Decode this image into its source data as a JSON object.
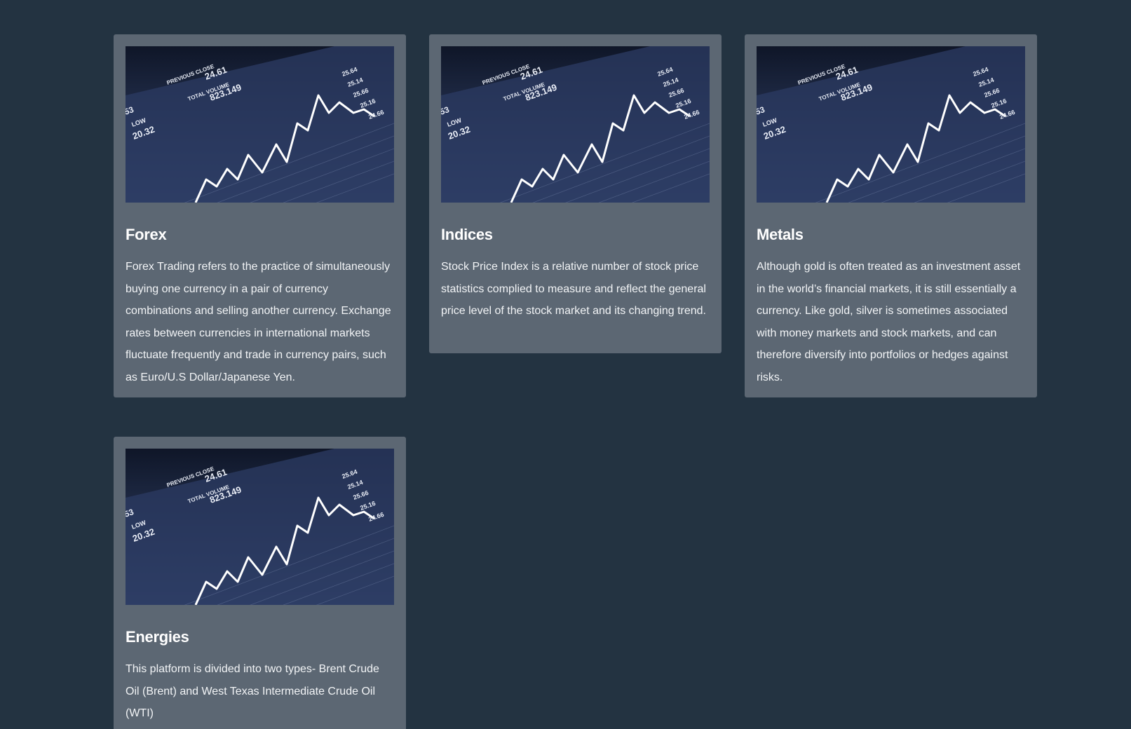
{
  "cards": [
    {
      "id": "forex",
      "image": {
        "icon": "stock-chart-image",
        "labels": {
          "previous_close_label": "PREVIOUS CLOSE",
          "previous_close_value": "24.61",
          "total_volume_label": "TOTAL VOLUME",
          "total_volume_value": "823.149",
          "low_label": "LOW",
          "low_value": "20.32",
          "left_value": "53",
          "right_values": [
            "25.64",
            "25.14",
            "25.66",
            "25.16",
            "24.66"
          ]
        }
      },
      "title": "Forex",
      "text": "Forex Trading refers to the practice of simultaneously buying one currency in a pair of currency combinations and selling another currency. Exchange rates between currencies in international markets fluctuate frequently and trade in currency pairs, such as Euro/U.S Dollar/Japanese Yen."
    },
    {
      "id": "indices",
      "image": {
        "icon": "stock-chart-image",
        "labels": {
          "previous_close_label": "PREVIOUS CLOSE",
          "previous_close_value": "24.61",
          "total_volume_label": "TOTAL VOLUME",
          "total_volume_value": "823.149",
          "low_label": "LOW",
          "low_value": "20.32",
          "left_value": "53",
          "right_values": [
            "25.64",
            "25.14",
            "25.66",
            "25.16",
            "24.66"
          ]
        }
      },
      "title": "Indices",
      "text": "Stock Price Index is a relative number of stock price statistics complied to measure and reflect the general price level of the stock market and its changing trend."
    },
    {
      "id": "metals",
      "image": {
        "icon": "stock-chart-image",
        "labels": {
          "previous_close_label": "PREVIOUS CLOSE",
          "previous_close_value": "24.61",
          "total_volume_label": "TOTAL VOLUME",
          "total_volume_value": "823.149",
          "low_label": "LOW",
          "low_value": "20.32",
          "left_value": "53",
          "right_values": [
            "25.64",
            "25.14",
            "25.66",
            "25.16",
            "24.66"
          ]
        }
      },
      "title": "Metals",
      "text": "Although gold is often treated as an investment asset in the world’s financial markets, it is still essentially a currency. Like gold, silver is sometimes associated with money markets and stock markets, and can therefore diversify into portfolios or hedges against risks."
    },
    {
      "id": "energies",
      "image": {
        "icon": "stock-chart-image",
        "labels": {
          "previous_close_label": "PREVIOUS CLOSE",
          "previous_close_value": "24.61",
          "total_volume_label": "TOTAL VOLUME",
          "total_volume_value": "823.149",
          "low_label": "LOW",
          "low_value": "20.32",
          "left_value": "53",
          "right_values": [
            "25.64",
            "25.14",
            "25.66",
            "25.16",
            "24.66"
          ]
        }
      },
      "title": "Energies",
      "text": "This platform is divided into two types- Brent Crude Oil (Brent) and West Texas Intermediate Crude Oil (WTI)"
    }
  ],
  "colors": {
    "page_background": "#233341",
    "card_background": "#5c6773",
    "image_background": "#1b2439",
    "image_line": "#ffffff"
  }
}
